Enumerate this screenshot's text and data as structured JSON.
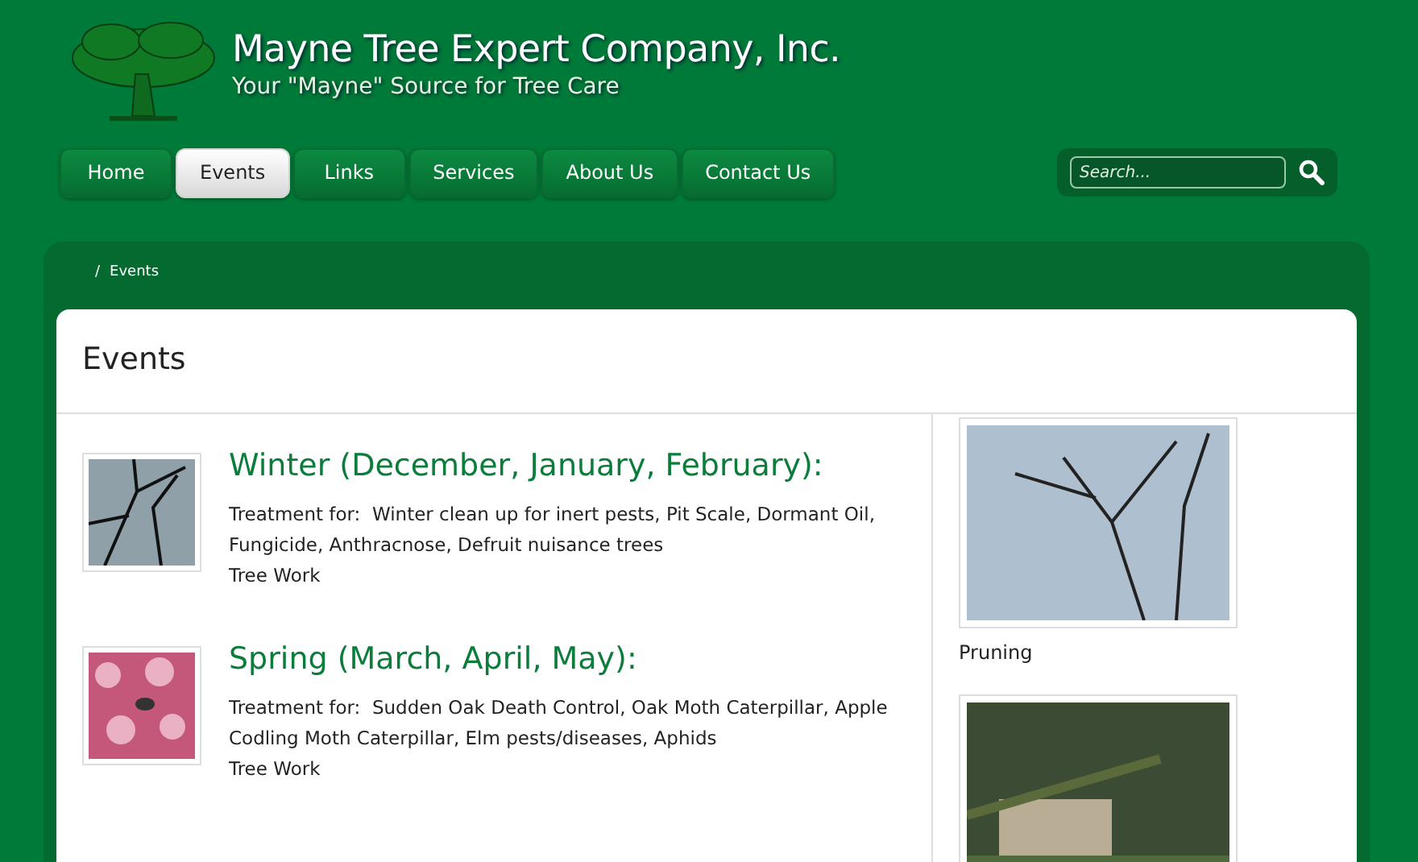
{
  "header": {
    "title": "Mayne Tree Expert Company, Inc.",
    "tagline": "Your \"Mayne\" Source for Tree Care"
  },
  "nav": [
    {
      "label": "Home",
      "selected": false
    },
    {
      "label": "Events",
      "selected": true
    },
    {
      "label": "Links",
      "selected": false
    },
    {
      "label": "Services",
      "selected": false
    },
    {
      "label": "About Us",
      "selected": false
    },
    {
      "label": "Contact Us",
      "selected": false
    }
  ],
  "search": {
    "placeholder": "Search..."
  },
  "breadcrumb": {
    "separator": "/",
    "current": "Events"
  },
  "page_title": "Events",
  "events": [
    {
      "title": "Winter (December, January, February):",
      "description": "Treatment for:  Winter clean up for inert pests, Pit Scale, Dormant Oil, Fungicide, Anthracnose, Defruit nuisance trees",
      "note": "Tree Work",
      "kind": "winter"
    },
    {
      "title": "Spring (March, April, May):",
      "description": "Treatment for:  Sudden Oak Death Control, Oak Moth Caterpillar, Apple Codling Moth Caterpillar, Elm pests/diseases, Aphids",
      "note": "Tree Work",
      "kind": "spring"
    }
  ],
  "gallery": [
    {
      "caption": "Pruning",
      "kind": "bare-tree"
    },
    {
      "kind": "garden"
    }
  ]
}
